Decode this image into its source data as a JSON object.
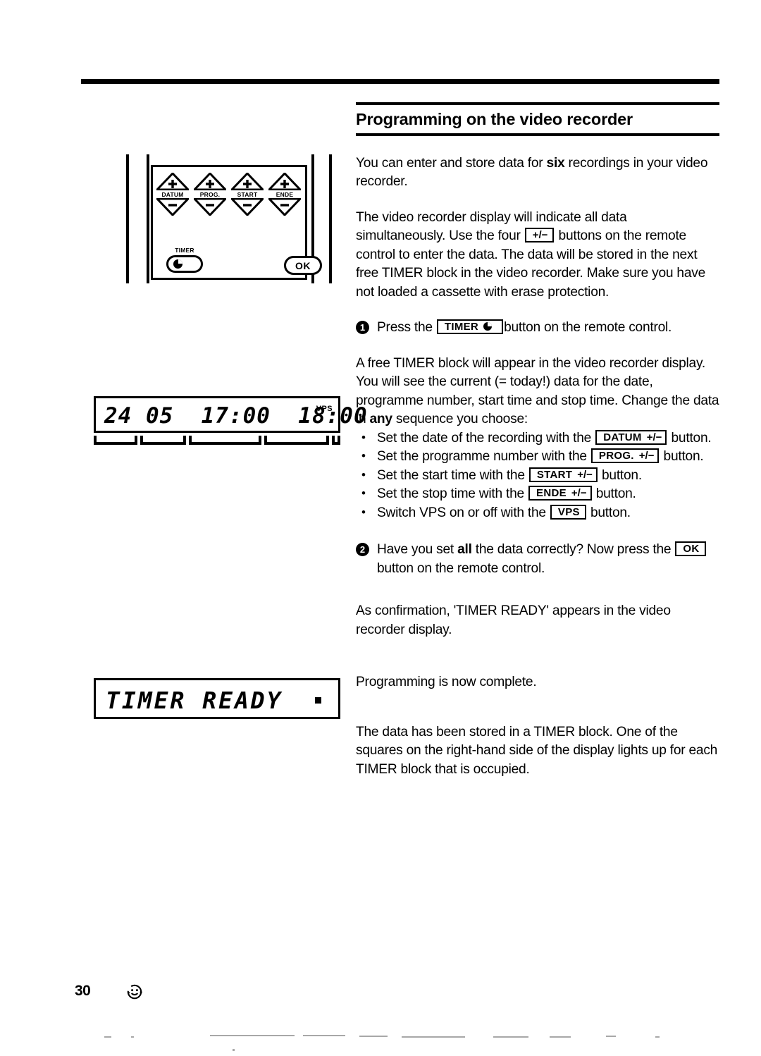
{
  "page": {
    "number": "30",
    "footer_icon": "recycle-smiley-icon"
  },
  "heading": "Programming on the video recorder",
  "intro": {
    "p1_before_bold": "You can enter and store data for ",
    "p1_bold": "six",
    "p1_after_bold": " recordings in your video recorder.",
    "p2_line1": "The video recorder display will indicate all data",
    "p2_line2_a": "simultaneously. Use the four ",
    "p2_line2_b": " buttons on the",
    "p2_line3": "remote control to enter the data.",
    "p2_line4": "The data will be stored in the next free TIMER block in the video recorder.",
    "p2_line5": "Make sure you have not loaded a cassette with erase protection."
  },
  "keys": {
    "plusminus": "+/−",
    "timer_label": "TIMER",
    "datum_label": "DATUM",
    "prog_label": "PROG.",
    "start_label": "START",
    "ende_label": "ENDE",
    "vps_label": "VPS",
    "ok_label": "OK"
  },
  "steps": [
    {
      "number": "1",
      "text_before_key": "Press the ",
      "text_after_key": "button on the remote control."
    },
    {
      "number": "2",
      "text_a": "Have you set ",
      "text_bold": "all",
      "text_b": " the data correctly? Now press the",
      "text_after_key": "button on the remote control."
    }
  ],
  "free_block_para": {
    "line1": "A free TIMER block will appear in the video recorder",
    "line2": "display. You will see the current (= today!) data for the",
    "line3": "date, programme number, start time and stop time.",
    "line4_a": "Change the data in ",
    "line4_bold": "any",
    "line4_b": " sequence you choose:"
  },
  "bullets": [
    {
      "before": "Set the date of the recording with the ",
      "key_label": "DATUM",
      "key_suffix": "+/−",
      "after": "button."
    },
    {
      "before": "Set the programme number with the ",
      "key_label": "PROG.",
      "key_suffix": "+/−",
      "after": "button."
    },
    {
      "before": "Set the start time with the ",
      "key_label": "START",
      "key_suffix": "+/−",
      "after": "button."
    },
    {
      "before": "Set the stop time with the ",
      "key_label": "ENDE",
      "key_suffix": "+/−",
      "after": "button."
    },
    {
      "before": "Switch VPS on or off with the ",
      "key_label": "VPS",
      "key_suffix": "",
      "after": "button."
    }
  ],
  "confirmation": {
    "line1": "As confirmation, 'TIMER READY' appears in the video",
    "line2": "recorder display."
  },
  "complete": "Programming is now complete.",
  "stored": {
    "line1": "The data has been stored in a TIMER block.",
    "line2": "One of the squares on the right-hand side of the display",
    "line3": "lights up for each TIMER block that is occupied."
  },
  "remote": {
    "buttons": [
      {
        "label": "DATUM",
        "up": "+",
        "down": "−"
      },
      {
        "label": "PROG.",
        "up": "+",
        "down": "−"
      },
      {
        "label": "START",
        "up": "+",
        "down": "−"
      },
      {
        "label": "ENDE",
        "up": "+",
        "down": "−"
      }
    ],
    "timer_label": "TIMER",
    "ok_label": "OK"
  },
  "display_1": {
    "text": "24 05  17:00  18:00",
    "date": "24",
    "month": "05",
    "start_time": "17:00",
    "stop_time": "18:00",
    "vps_indicator": "VPS"
  },
  "display_2": {
    "text": "TIMER READY",
    "block_indicator": "filled-square"
  },
  "colors": {
    "ink": "#000000",
    "paper": "#ffffff"
  }
}
